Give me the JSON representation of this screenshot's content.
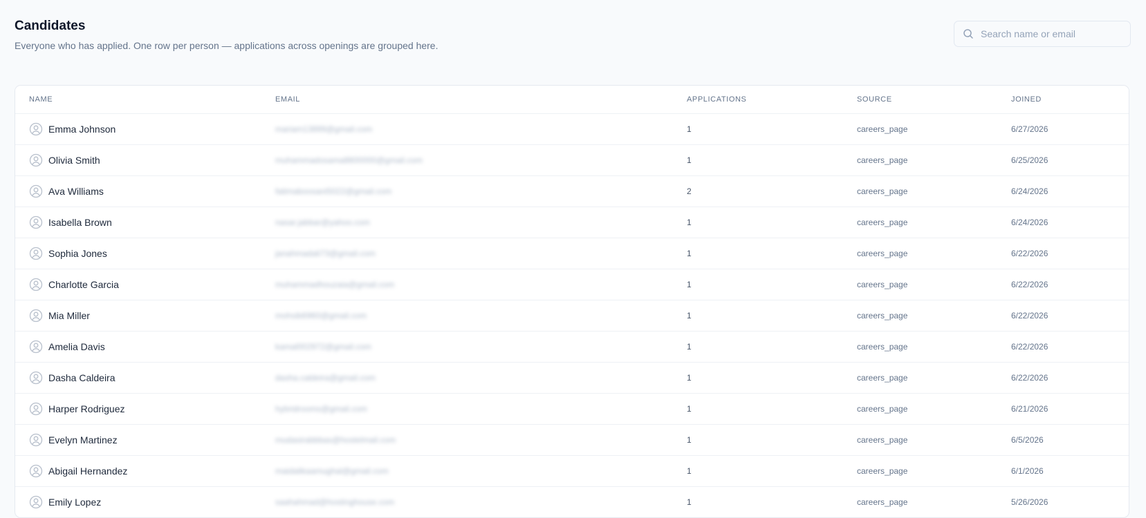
{
  "header": {
    "title": "Candidates",
    "subtitle": "Everyone who has applied. One row per person — applications across openings are grouped here."
  },
  "search": {
    "placeholder": "Search name or email",
    "value": ""
  },
  "table": {
    "columns": [
      "NAME",
      "EMAIL",
      "APPLICATIONS",
      "SOURCE",
      "JOINED"
    ],
    "rows": [
      {
        "name": "Emma Johnson",
        "email": "mariam13899@gmail.com",
        "applications": "1",
        "source": "careers_page",
        "joined": "6/27/2026"
      },
      {
        "name": "Olivia Smith",
        "email": "muhammadosama8800000@gmail.com",
        "applications": "1",
        "source": "careers_page",
        "joined": "6/25/2026"
      },
      {
        "name": "Ava Williams",
        "email": "fatimaboosani5022@gmail.com",
        "applications": "2",
        "source": "careers_page",
        "joined": "6/24/2026"
      },
      {
        "name": "Isabella Brown",
        "email": "nasar.jabbar@yahoo.com",
        "applications": "1",
        "source": "careers_page",
        "joined": "6/24/2026"
      },
      {
        "name": "Sophia Jones",
        "email": "janahmadali73@gmail.com",
        "applications": "1",
        "source": "careers_page",
        "joined": "6/22/2026"
      },
      {
        "name": "Charlotte Garcia",
        "email": "muhammadhouzaia@gmail.com",
        "applications": "1",
        "source": "careers_page",
        "joined": "6/22/2026"
      },
      {
        "name": "Mia Miller",
        "email": "mohsib6960@gmail.com",
        "applications": "1",
        "source": "careers_page",
        "joined": "6/22/2026"
      },
      {
        "name": "Amelia Davis",
        "email": "kamal002972@gmail.com",
        "applications": "1",
        "source": "careers_page",
        "joined": "6/22/2026"
      },
      {
        "name": "Dasha Caldeira",
        "email": "dasha.caldeira@gmail.com",
        "applications": "1",
        "source": "careers_page",
        "joined": "6/22/2026"
      },
      {
        "name": "Harper Rodriguez",
        "email": "hybridrooms@gmail.com",
        "applications": "1",
        "source": "careers_page",
        "joined": "6/21/2026"
      },
      {
        "name": "Evelyn Martinez",
        "email": "mudasirabbbas@hostelmail.com",
        "applications": "1",
        "source": "careers_page",
        "joined": "6/5/2026"
      },
      {
        "name": "Abigail Hernandez",
        "email": "maidalikaamughal@gmail.com",
        "applications": "1",
        "source": "careers_page",
        "joined": "6/1/2026"
      },
      {
        "name": "Emily Lopez",
        "email": "saahahmad@hostinghouse.com",
        "applications": "1",
        "source": "careers_page",
        "joined": "5/26/2026"
      }
    ]
  },
  "icons": {
    "search": "search-icon",
    "avatar": "user-circle-icon"
  },
  "colors": {
    "background": "#f8fafc",
    "border": "#e5e9f0",
    "text_primary": "#0f172a",
    "text_muted": "#64748b"
  }
}
